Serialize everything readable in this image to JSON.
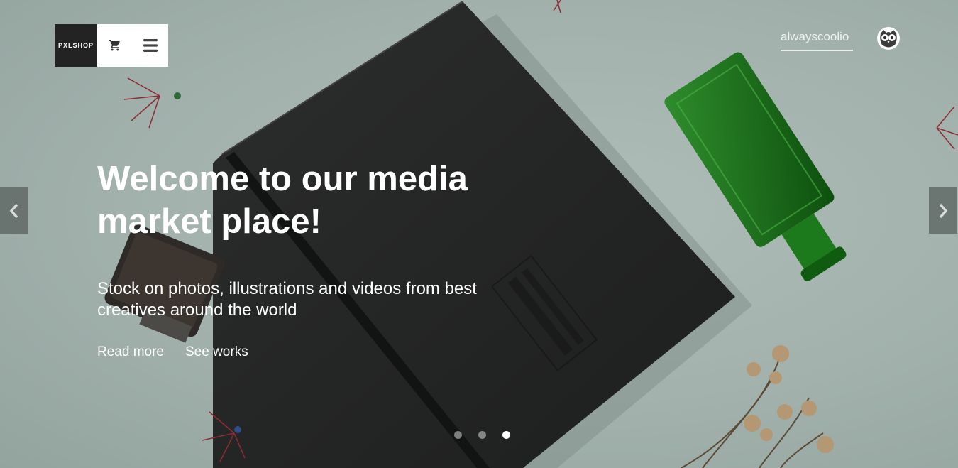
{
  "header": {
    "logo_text": "PXLSHOP",
    "cart_icon": "cart-icon",
    "menu_icon": "menu-icon",
    "username": "alwayscoolio",
    "avatar_icon": "owl-avatar-icon"
  },
  "hero": {
    "title": "Welcome to our media market place!",
    "subtitle": "Stock on photos, illustrations and videos from best creatives around the world",
    "links": [
      "Read more",
      "See works"
    ]
  },
  "carousel": {
    "prev_icon": "chevron-left-icon",
    "next_icon": "chevron-right-icon",
    "slide_count": 3,
    "active_slide": 3
  },
  "colors": {
    "background": "#a3b3ae",
    "logo_bg": "#232323",
    "text": "#ffffff"
  }
}
